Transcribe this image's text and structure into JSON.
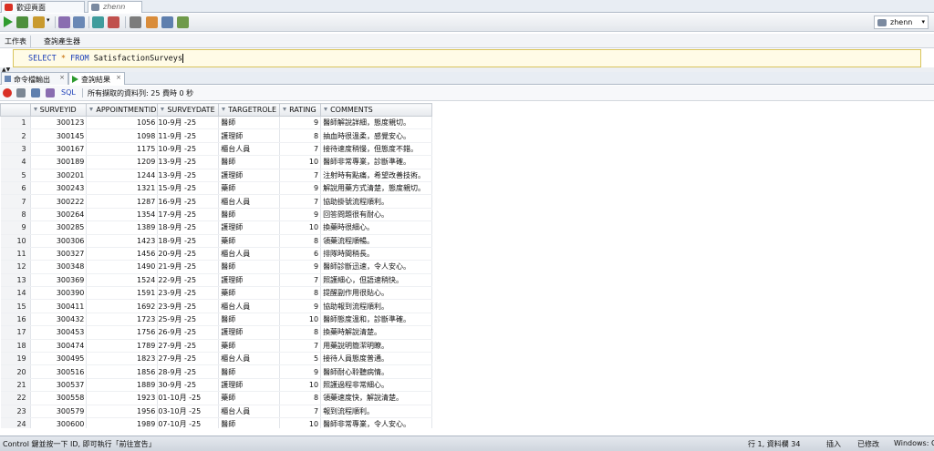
{
  "doc_tabs": [
    {
      "label": "歡迎頁面"
    },
    {
      "label": "zhenn"
    }
  ],
  "connection": {
    "label": "zhenn"
  },
  "subtabs": [
    {
      "label": "工作表"
    },
    {
      "label": "查詢產生器"
    }
  ],
  "editor": {
    "kw_select": "SELECT",
    "star": "*",
    "kw_from": "FROM",
    "table": "SatisfactionSurveys"
  },
  "result_tabs": [
    {
      "label": "命令檔輸出"
    },
    {
      "label": "查詢結果"
    }
  ],
  "result_toolbar": {
    "sql_label": "SQL",
    "message": "所有擷取的資料列: 25 費時 0 秒"
  },
  "grid": {
    "columns": [
      "SURVEYID",
      "APPOINTMENTID",
      "SURVEYDATE",
      "TARGETROLE",
      "RATING",
      "COMMENTS"
    ],
    "rows": [
      [
        "1",
        "300123",
        "1056",
        "10-9月 -25",
        "醫師",
        "9",
        "醫師解說詳細，態度親切。"
      ],
      [
        "2",
        "300145",
        "1098",
        "11-9月 -25",
        "護理師",
        "8",
        "抽血時很溫柔，感覺安心。"
      ],
      [
        "3",
        "300167",
        "1175",
        "10-9月 -25",
        "櫃台人員",
        "7",
        "接待速度稍慢，但態度不錯。"
      ],
      [
        "4",
        "300189",
        "1209",
        "13-9月 -25",
        "醫師",
        "10",
        "醫師非常專業，診斷準確。"
      ],
      [
        "5",
        "300201",
        "1244",
        "13-9月 -25",
        "護理師",
        "7",
        "注射時有點痛，希望改善技術。"
      ],
      [
        "6",
        "300243",
        "1321",
        "15-9月 -25",
        "藥師",
        "9",
        "解說用藥方式清楚，態度親切。"
      ],
      [
        "7",
        "300222",
        "1287",
        "16-9月 -25",
        "櫃台人員",
        "7",
        "協助掛號流程順利。"
      ],
      [
        "8",
        "300264",
        "1354",
        "17-9月 -25",
        "醫師",
        "9",
        "回答問題很有耐心。"
      ],
      [
        "9",
        "300285",
        "1389",
        "18-9月 -25",
        "護理師",
        "10",
        "換藥時很細心。"
      ],
      [
        "10",
        "300306",
        "1423",
        "18-9月 -25",
        "藥師",
        "8",
        "領藥流程順暢。"
      ],
      [
        "11",
        "300327",
        "1456",
        "20-9月 -25",
        "櫃台人員",
        "6",
        "排隊時間稍長。"
      ],
      [
        "12",
        "300348",
        "1490",
        "21-9月 -25",
        "醫師",
        "9",
        "醫師診斷迅速，令人安心。"
      ],
      [
        "13",
        "300369",
        "1524",
        "22-9月 -25",
        "護理師",
        "7",
        "照護細心，但語速稍快。"
      ],
      [
        "14",
        "300390",
        "1591",
        "23-9月 -25",
        "藥師",
        "8",
        "提醒副作用很貼心。"
      ],
      [
        "15",
        "300411",
        "1692",
        "23-9月 -25",
        "櫃台人員",
        "9",
        "協助報到流程順利。"
      ],
      [
        "16",
        "300432",
        "1723",
        "25-9月 -25",
        "醫師",
        "10",
        "醫師態度溫和，診斷準確。"
      ],
      [
        "17",
        "300453",
        "1756",
        "26-9月 -25",
        "護理師",
        "8",
        "換藥時解說清楚。"
      ],
      [
        "18",
        "300474",
        "1789",
        "27-9月 -25",
        "藥師",
        "7",
        "用藥說明簡潔明瞭。"
      ],
      [
        "19",
        "300495",
        "1823",
        "27-9月 -25",
        "櫃台人員",
        "5",
        "接待人員態度普通。"
      ],
      [
        "20",
        "300516",
        "1856",
        "28-9月 -25",
        "醫師",
        "9",
        "醫師耐心聆聽病情。"
      ],
      [
        "21",
        "300537",
        "1889",
        "30-9月 -25",
        "護理師",
        "10",
        "照護過程非常細心。"
      ],
      [
        "22",
        "300558",
        "1923",
        "01-10月 -25",
        "藥師",
        "8",
        "領藥速度快，解說清楚。"
      ],
      [
        "23",
        "300579",
        "1956",
        "03-10月 -25",
        "櫃台人員",
        "7",
        "報到流程順利。"
      ],
      [
        "24",
        "300600",
        "1989",
        "07-10月 -25",
        "醫師",
        "10",
        "醫師非常專業，令人安心。"
      ]
    ]
  },
  "status": {
    "message": "Control 鍵並按一下 ID, 即可執行「前往宣告」",
    "position": "行 1, 資料欄 34",
    "insert": "插入",
    "modified": "已修改",
    "line_ending": "Windows: CR"
  },
  "colors": {
    "accent": "#1d3fb8",
    "editor_bg": "#fffbe6",
    "editor_border": "#d8c45c",
    "run_green": "#2e9b2e"
  },
  "icons": [
    "run-icon",
    "run-script-icon",
    "commit-icon",
    "rollback-icon",
    "autotrace-icon",
    "explain-plan-icon",
    "pin-icon",
    "print-icon",
    "export-icon",
    "refresh-icon"
  ]
}
